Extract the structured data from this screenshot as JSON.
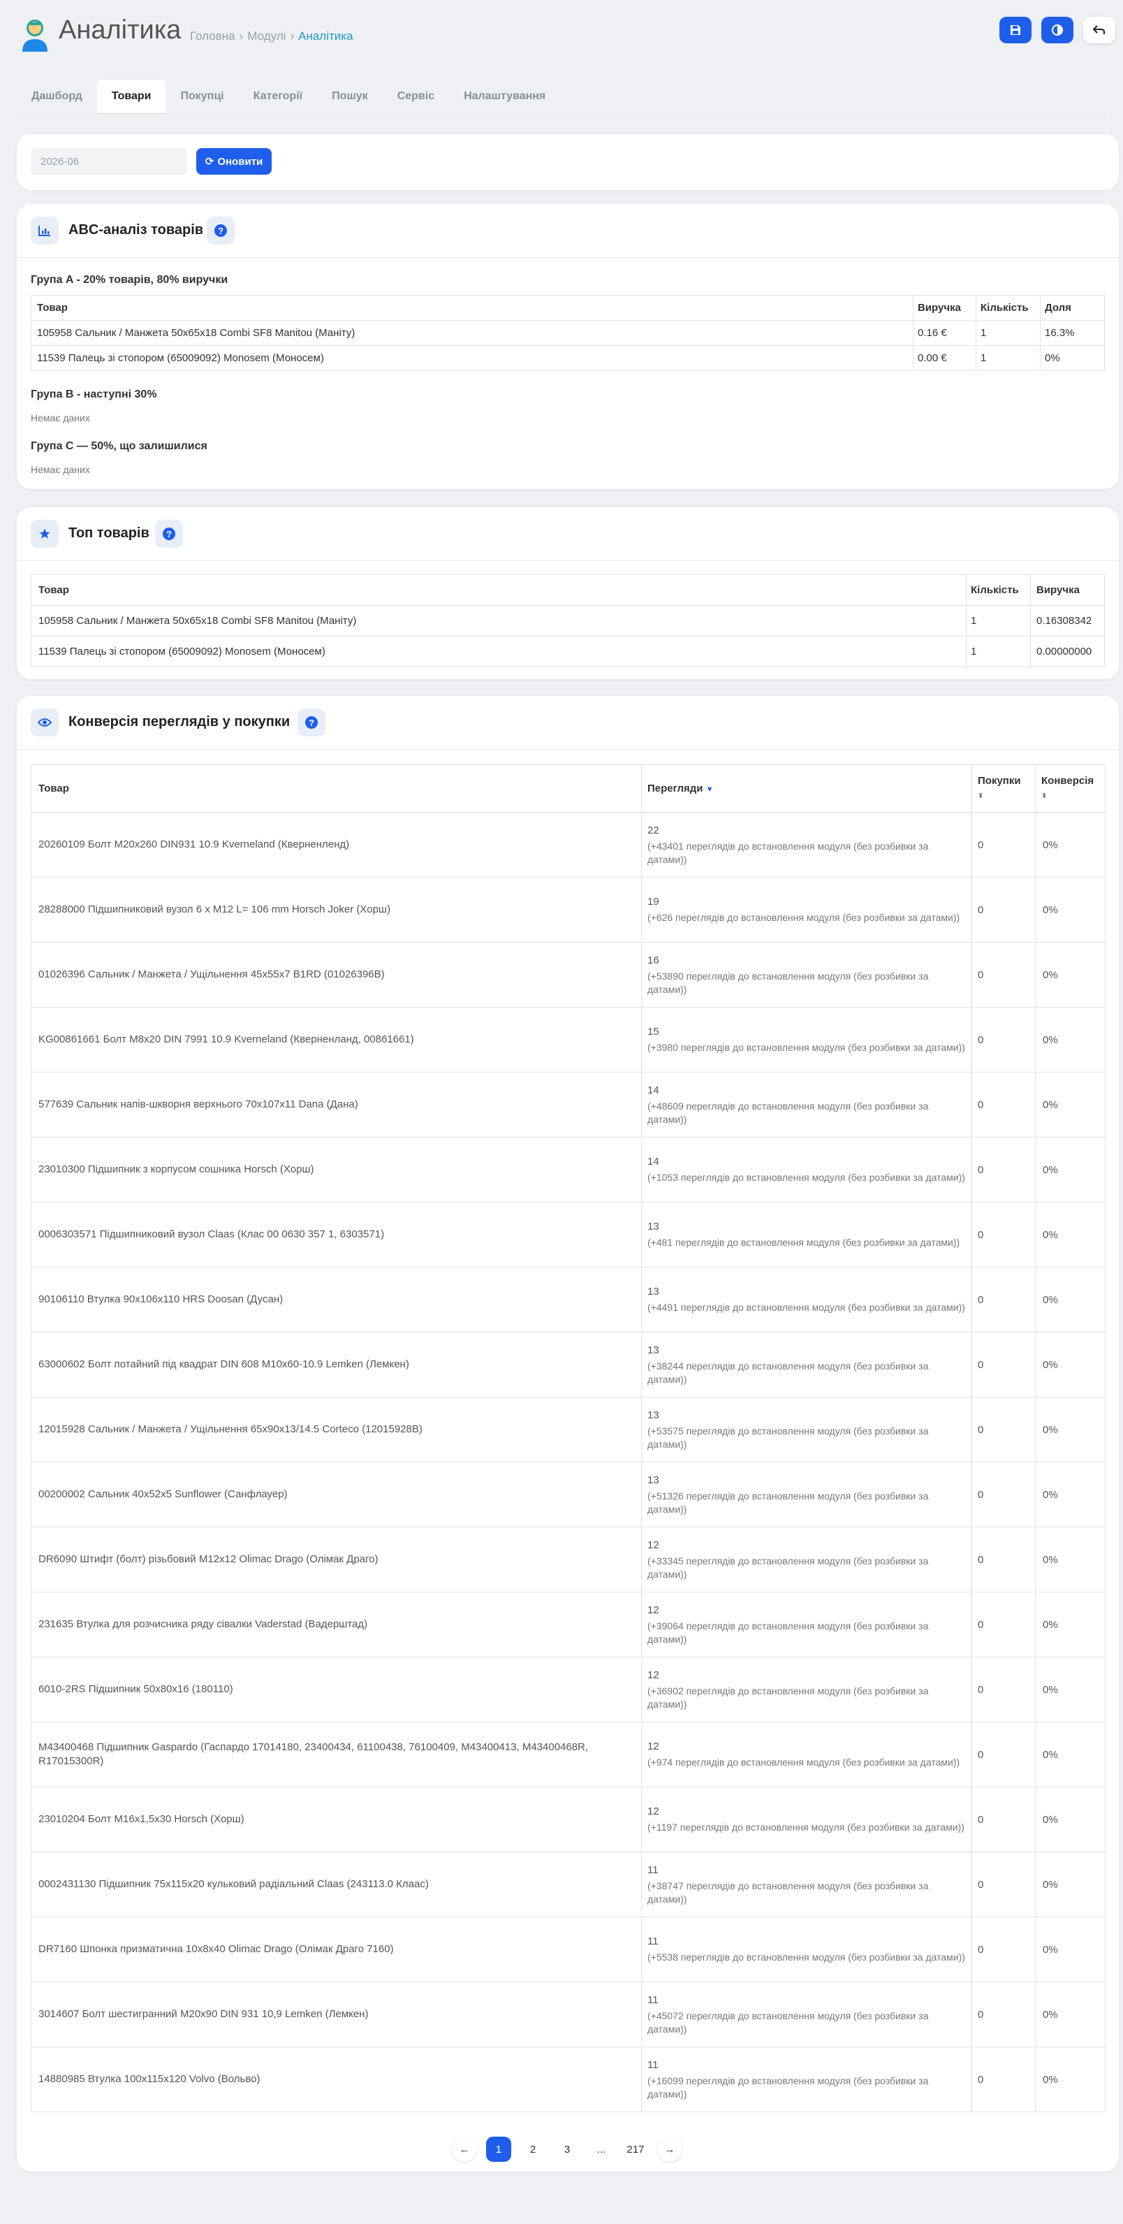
{
  "header": {
    "title": "Аналітика",
    "breadcrumb": [
      "Головна",
      "Модулі",
      "Аналітика"
    ]
  },
  "tabs": [
    "Дашборд",
    "Товари",
    "Покупці",
    "Категорії",
    "Пошук",
    "Сервіс",
    "Налаштування"
  ],
  "filter": {
    "month_value": "2026-06",
    "refresh_label": "Оновити"
  },
  "abc": {
    "title": "ABC-аналіз товарів",
    "group_a": "Група A - 20% товарів, 80% виручки",
    "headers": [
      "Товар",
      "Виручка",
      "Кількість",
      "Доля"
    ],
    "rows": [
      [
        "105958 Сальник / Манжета 50x65x18 Combi SF8 Manitou (Маніту)",
        "0.16 €",
        "1",
        "16.3%"
      ],
      [
        "11539 Палець зі стопором (65009092) Monosem (Моносем)",
        "0.00 €",
        "1",
        "0%"
      ]
    ],
    "group_b": "Група B - наступні 30%",
    "group_b_empty": "Немає даних",
    "group_c": "Група C — 50%, що залишилися",
    "group_c_empty": "Немає даних"
  },
  "top": {
    "title": "Топ товарів",
    "headers": [
      "Товар",
      "Кількість",
      "Виручка"
    ],
    "rows": [
      [
        "105958 Сальник / Манжета 50x65x18 Combi SF8 Manitou (Маніту)",
        "1",
        "0.16308342"
      ],
      [
        "11539 Палець зі стопором (65009092) Monosem (Моносем)",
        "1",
        "0.00000000"
      ]
    ]
  },
  "conversion": {
    "title": "Конверсія переглядів у покупки",
    "headers": [
      "Товар",
      "Перегляди",
      "Покупки",
      "Конверсія"
    ],
    "rows": [
      {
        "product": "20260109 Болт M20x260 DIN931 10.9 Kverneland (Кверненленд)",
        "views": "22",
        "note": "(+43401 переглядів до встановлення модуля (без розбивки за датами))",
        "purchases": "0",
        "conv": "0%"
      },
      {
        "product": "28288000 Підшипниковий вузол 6 x M12 L= 106 mm Horsch Joker (Хорш)",
        "views": "19",
        "note": "(+626 переглядів до встановлення модуля (без розбивки за датами))",
        "purchases": "0",
        "conv": "0%"
      },
      {
        "product": "01026396 Сальник / Манжета / Ущільнення 45x55x7 B1RD (01026396B)",
        "views": "16",
        "note": "(+53890 переглядів до встановлення модуля (без розбивки за датами))",
        "purchases": "0",
        "conv": "0%"
      },
      {
        "product": "KG00861661 Болт M8x20 DIN 7991 10.9 Kverneland (Кверненланд, 00861661)",
        "views": "15",
        "note": "(+3980 переглядів до встановлення модуля (без розбивки за датами))",
        "purchases": "0",
        "conv": "0%"
      },
      {
        "product": "577639 Сальник напів-шкворня верхнього 70x107x11 Dana (Дана)",
        "views": "14",
        "note": "(+48609 переглядів до встановлення модуля (без розбивки за датами))",
        "purchases": "0",
        "conv": "0%"
      },
      {
        "product": "23010300 Підшипник з корпусом сошника Horsch (Хорш)",
        "views": "14",
        "note": "(+1053 переглядів до встановлення модуля (без розбивки за датами))",
        "purchases": "0",
        "conv": "0%"
      },
      {
        "product": "0006303571 Підшипниковий вузол Claas (Клас 00 0630 357 1, 6303571)",
        "views": "13",
        "note": "(+481 переглядів до встановлення модуля (без розбивки за датами))",
        "purchases": "0",
        "conv": "0%"
      },
      {
        "product": "90106110 Втулка 90x106x110 HRS Doosan (Дусан)",
        "views": "13",
        "note": "(+4491 переглядів до встановлення модуля (без розбивки за датами))",
        "purchases": "0",
        "conv": "0%"
      },
      {
        "product": "63000602 Болт потайний під квадрат DIN 608 M10x60-10.9 Lemken (Лемкен)",
        "views": "13",
        "note": "(+38244 переглядів до встановлення модуля (без розбивки за датами))",
        "purchases": "0",
        "conv": "0%"
      },
      {
        "product": "12015928 Сальник / Манжета / Ущільнення 65x90x13/14.5 Corteco (12015928B)",
        "views": "13",
        "note": "(+53575 переглядів до встановлення модуля (без розбивки за датами))",
        "purchases": "0",
        "conv": "0%"
      },
      {
        "product": "00200002 Сальник 40x52x5 Sunflower (Санфлауер)",
        "views": "13",
        "note": "(+51326 переглядів до встановлення модуля (без розбивки за датами))",
        "purchases": "0",
        "conv": "0%"
      },
      {
        "product": "DR6090 Штифт (болт) різьбовий M12x12 Olimac Drago (Олімак Драго)",
        "views": "12",
        "note": "(+33345 переглядів до встановлення модуля (без розбивки за датами))",
        "purchases": "0",
        "conv": "0%"
      },
      {
        "product": "231635 Втулка для розчисника ряду сівалки Vaderstad (Вадерштад)",
        "views": "12",
        "note": "(+39064 переглядів до встановлення модуля (без розбивки за датами))",
        "purchases": "0",
        "conv": "0%"
      },
      {
        "product": "6010-2RS Підшипник 50x80x16 (180110)",
        "views": "12",
        "note": "(+36902 переглядів до встановлення модуля (без розбивки за датами))",
        "purchases": "0",
        "conv": "0%"
      },
      {
        "product": "M43400468 Підшипник Gaspardo (Гаспардо 17014180, 23400434, 61100438, 76100409, M43400413, M43400468R, R17015300R)",
        "views": "12",
        "note": "(+974 переглядів до встановлення модуля (без розбивки за датами))",
        "purchases": "0",
        "conv": "0%"
      },
      {
        "product": "23010204 Болт M16x1,5x30 Horsch (Хорш)",
        "views": "12",
        "note": "(+1197 переглядів до встановлення модуля (без розбивки за датами))",
        "purchases": "0",
        "conv": "0%"
      },
      {
        "product": "0002431130 Підшипник 75x115x20 кульковий радіальний Claas (243113.0 Клаас)",
        "views": "11",
        "note": "(+38747 переглядів до встановлення модуля (без розбивки за датами))",
        "purchases": "0",
        "conv": "0%"
      },
      {
        "product": "DR7160 Шпонка призматична 10x8x40 Olimac Drago (Олімак Драго 7160)",
        "views": "11",
        "note": "(+5538 переглядів до встановлення модуля (без розбивки за датами))",
        "purchases": "0",
        "conv": "0%"
      },
      {
        "product": "3014607 Болт шестигранний M20x90 DIN 931 10,9 Lemken (Лемкен)",
        "views": "11",
        "note": "(+45072 переглядів до встановлення модуля (без розбивки за датами))",
        "purchases": "0",
        "conv": "0%"
      },
      {
        "product": "14880985 Втулка 100x115x120 Volvo (Вольво)",
        "views": "11",
        "note": "(+16099 переглядів до встановлення модуля (без розбивки за датами))",
        "purchases": "0",
        "conv": "0%"
      }
    ]
  },
  "pagination": {
    "pages": [
      "1",
      "2",
      "3",
      "...",
      "217"
    ],
    "current": "1"
  },
  "colors": {
    "accent": "#1e5eea",
    "link": "#2196c9",
    "background": "#eef0f3"
  }
}
